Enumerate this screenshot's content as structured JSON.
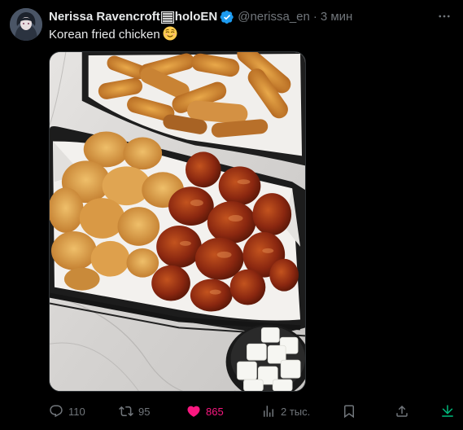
{
  "tweet": {
    "author_name": "Nerissa Ravencroft",
    "author_name_suffix": "holoEN",
    "handle": "@nerissa_en",
    "separator": "·",
    "time": "3 мин",
    "text": "Korean fried chicken",
    "emoji": "relieved-face"
  },
  "actions": {
    "replies": "110",
    "retweets": "95",
    "likes": "865",
    "views": "2 тыс."
  },
  "colors": {
    "background": "#000000",
    "text": "#e7e9ea",
    "muted": "#71767b",
    "like_active": "#f91880",
    "verified": "#1d9bf0"
  },
  "icons": {
    "more": "more-icon",
    "verified": "verified-badge-icon",
    "reply": "reply-icon",
    "retweet": "retweet-icon",
    "like": "heart-icon",
    "views": "views-icon",
    "bookmark": "bookmark-icon",
    "share": "share-icon",
    "download": "download-icon"
  }
}
